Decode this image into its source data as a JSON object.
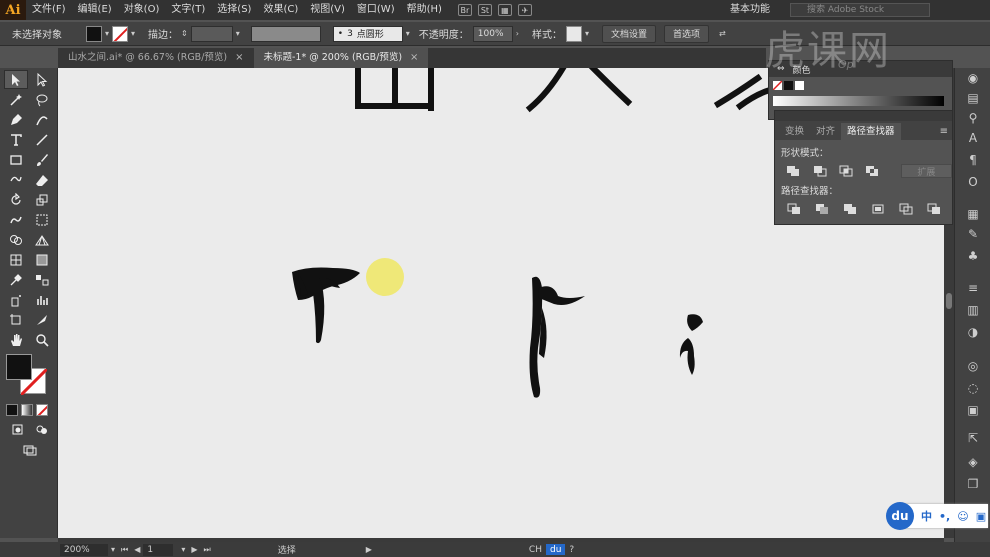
{
  "app": {
    "logo": "Ai"
  },
  "menu": [
    "文件(F)",
    "编辑(E)",
    "对象(O)",
    "文字(T)",
    "选择(S)",
    "效果(C)",
    "视图(V)",
    "窗口(W)",
    "帮助(H)"
  ],
  "menu_icons": [
    "Br",
    "St"
  ],
  "workspace": "基本功能",
  "stock_search": {
    "placeholder": "搜索 Adobe Stock"
  },
  "control": {
    "selection": "未选择对象",
    "stroke_label": "描边：",
    "brush_size": "3",
    "brush_name": "点圆形",
    "opacity_label": "不透明度：",
    "opacity": "100%",
    "style_label": "样式：",
    "doc_setup": "文档设置",
    "preferences": "首选项"
  },
  "tabs": [
    {
      "label": "山水之间.ai* @ 66.67% (RGB/预览)",
      "active": false
    },
    {
      "label": "未标题-1* @ 200% (RGB/预览)",
      "active": true
    }
  ],
  "color_panel": {
    "title": "颜色"
  },
  "pathfinder": {
    "tabs": [
      "变换",
      "对齐",
      "路径查找器"
    ],
    "active_tab": "路径查找器",
    "shape_modes_label": "形状模式：",
    "expand_label": "扩展",
    "pathfinders_label": "路径查找器："
  },
  "status": {
    "zoom": "200%",
    "page": "1",
    "tool": "选择",
    "lang": "CH"
  },
  "watermark": {
    "text": "虎课网",
    "sub": "Op"
  },
  "ime": {
    "logo": "du",
    "lang": "中"
  },
  "colors": {
    "fill": "#111111",
    "stroke": "#ffffff",
    "accent": "#2468c9"
  }
}
